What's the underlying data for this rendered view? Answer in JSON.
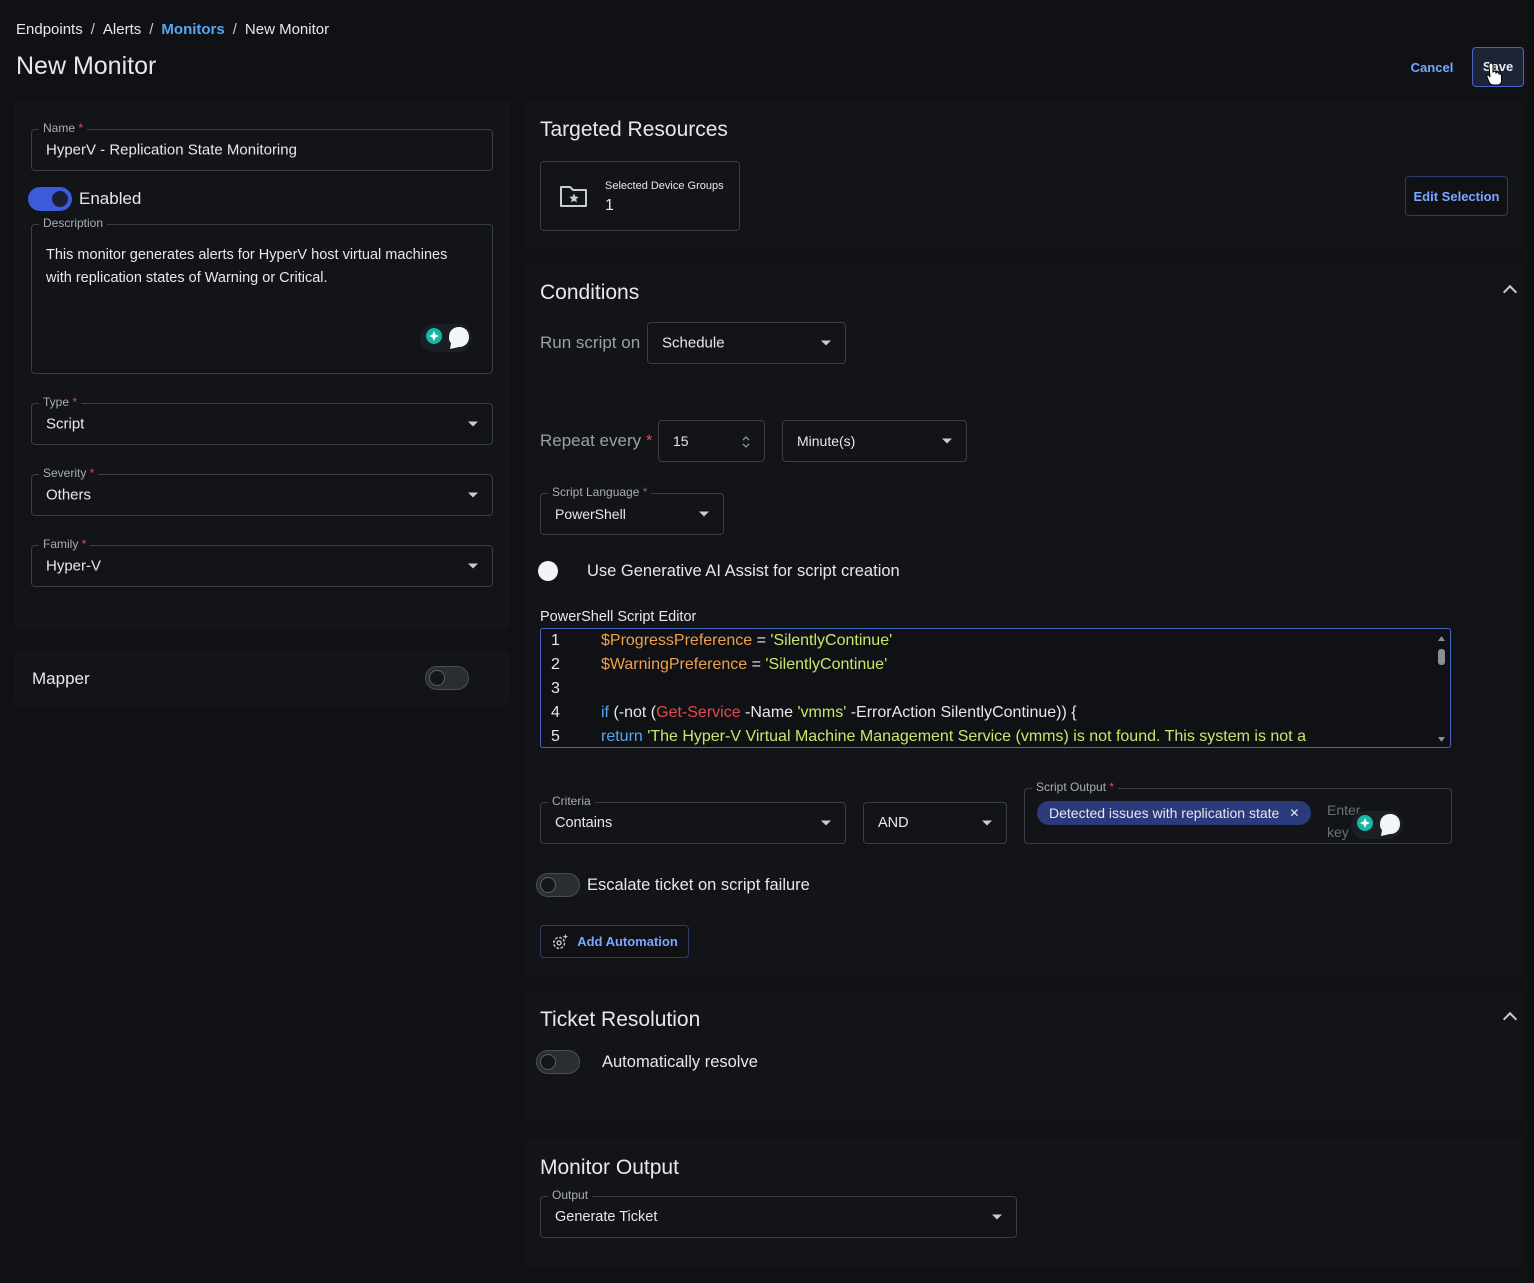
{
  "breadcrumb": [
    "Endpoints",
    "Alerts",
    "Monitors",
    "New Monitor"
  ],
  "breadcrumb_sep": "/",
  "page_title": "New Monitor",
  "actions": {
    "cancel": "Cancel",
    "save": "Save"
  },
  "colors": {
    "accent": "#3b5bdb",
    "link": "#58a6f0",
    "background": "#0f1114",
    "panel": "#121417",
    "required": "#e5484d"
  },
  "left": {
    "name_label": "Name",
    "name_value": "HyperV - Replication State Monitoring",
    "enabled_label": "Enabled",
    "enabled": true,
    "description_label": "Description",
    "description_value": "This monitor generates alerts for HyperV host virtual machines with replication states of Warning or Critical.",
    "type_label": "Type",
    "type_value": "Script",
    "severity_label": "Severity",
    "severity_value": "Others",
    "family_label": "Family",
    "family_value": "Hyper-V",
    "required_mark": "*",
    "mapper_label": "Mapper",
    "mapper_enabled": false
  },
  "targeted": {
    "title": "Targeted Resources",
    "card_label": "Selected Device Groups",
    "card_value": "1",
    "card_icon": "folder-star-icon",
    "edit_button": "Edit Selection"
  },
  "conditions": {
    "title": "Conditions",
    "run_script_label": "Run script on",
    "run_script_value": "Schedule",
    "repeat_label": "Repeat every",
    "repeat_value": "15",
    "repeat_unit": "Minute(s)",
    "script_language_label": "Script Language",
    "script_language_value": "PowerShell",
    "ai_assist_label": "Use Generative AI Assist for script creation",
    "editor_label": "PowerShell Script Editor",
    "code_lines": [
      {
        "n": "1",
        "tokens": [
          [
            "var",
            "$ProgressPreference"
          ],
          [
            "txt",
            " = "
          ],
          [
            "str",
            "'SilentlyContinue'"
          ]
        ]
      },
      {
        "n": "2",
        "tokens": [
          [
            "var",
            "$WarningPreference"
          ],
          [
            "txt",
            " = "
          ],
          [
            "str",
            "'SilentlyContinue'"
          ]
        ]
      },
      {
        "n": "3",
        "tokens": []
      },
      {
        "n": "4",
        "tokens": [
          [
            "kw",
            "if"
          ],
          [
            "txt",
            " (-not ("
          ],
          [
            "cmd",
            "Get-Service"
          ],
          [
            "txt",
            " -Name "
          ],
          [
            "str",
            "'vmms'"
          ],
          [
            "txt",
            " -ErrorAction SilentlyContinue)) {"
          ]
        ]
      },
      {
        "n": "5",
        "tokens": [
          [
            "txt",
            "   "
          ],
          [
            "kw",
            "return"
          ],
          [
            "txt",
            " "
          ],
          [
            "str",
            "'The Hyper-V Virtual Machine Management Service (vmms) is not found. This system is not a"
          ]
        ]
      }
    ],
    "criteria_label": "Criteria",
    "criteria_value": "Contains",
    "logic_value": "AND",
    "script_output_label": "Script Output",
    "script_output_chip": "Detected issues with replication state",
    "script_output_placeholder": "Enter key",
    "escalate_label": "Escalate ticket on script failure",
    "add_automation": "Add Automation"
  },
  "ticket_resolution": {
    "title": "Ticket Resolution",
    "auto_resolve_label": "Automatically resolve"
  },
  "monitor_output": {
    "title": "Monitor Output",
    "output_label": "Output",
    "output_value": "Generate Ticket"
  }
}
